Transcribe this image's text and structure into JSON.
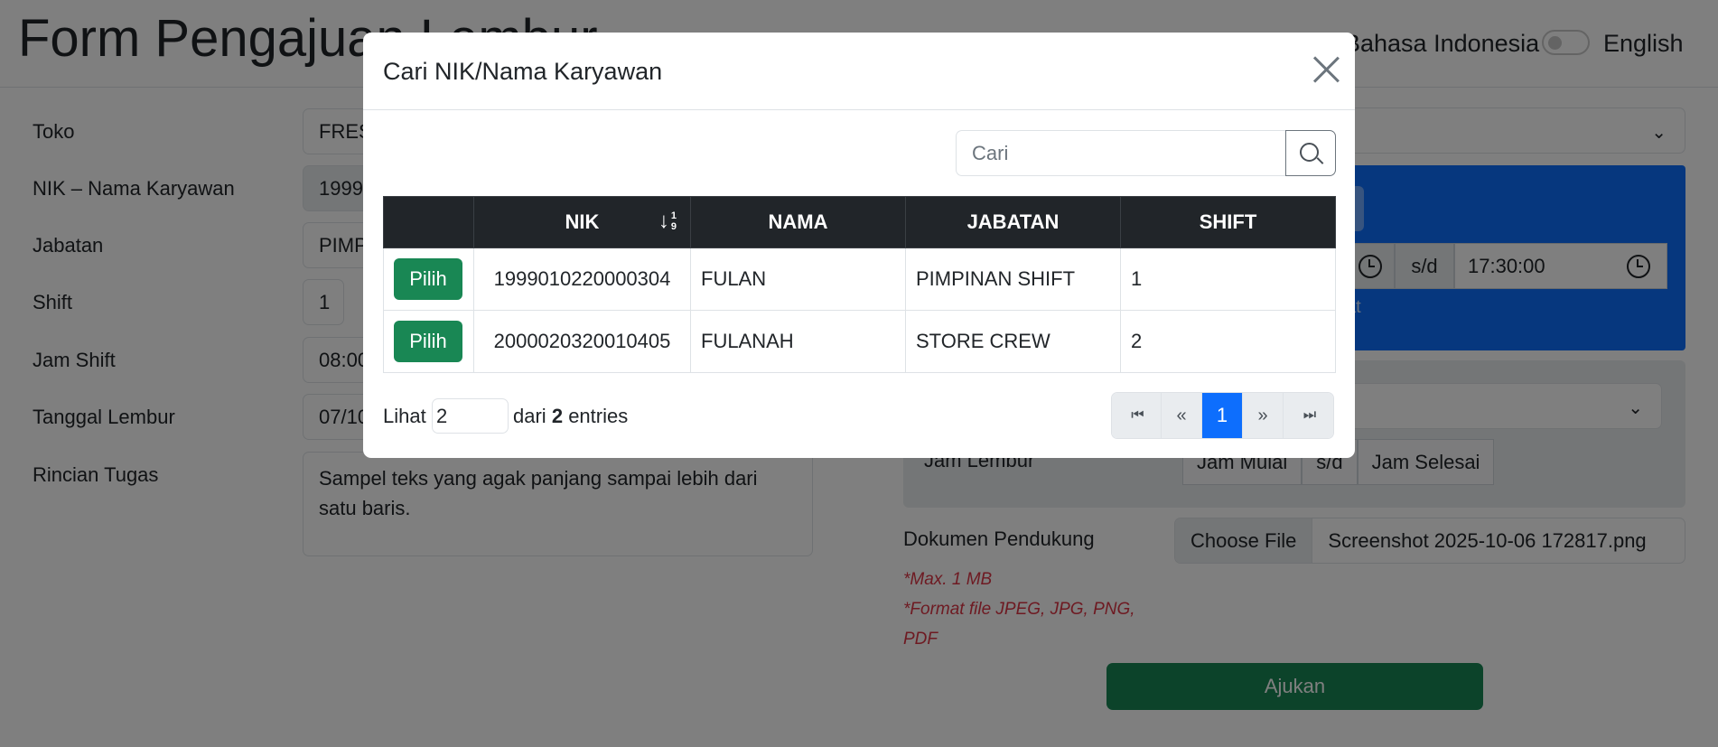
{
  "page": {
    "title": "Form Pengajuan Lembur",
    "lang_id": "Bahasa Indonesia",
    "lang_en": "English"
  },
  "form": {
    "toko_label": "Toko",
    "toko_value": "FRESH",
    "nik_label": "NIK – Nama Karyawan",
    "nik_value": "1999",
    "jabatan_label": "Jabatan",
    "jabatan_value": "PIMP",
    "shift_label": "Shift",
    "shift_value": "1",
    "jam_shift_label": "Jam Shift",
    "jam_shift_value": "08:00",
    "tanggal_label": "Tanggal Lembur",
    "tanggal_value": "07/10",
    "rincian_label": "Rincian Tugas",
    "rincian_value": "Sampel teks yang agak panjang sampai lebih dari satu baris."
  },
  "right": {
    "sd": "s/d",
    "end_time": "17:30:00",
    "blue_note": "at",
    "jam_lembur_label": "Jam Lembur",
    "jam_mulai": "Jam Mulai",
    "jam_sd": "s/d",
    "jam_selesai": "Jam Selesai",
    "dokumen_label": "Dokumen Pendukung",
    "choose_file": "Choose File",
    "file_name": "Screenshot 2025-10-06 172817.png",
    "note_max": "*Max. 1 MB",
    "note_format_1": "*Format file JPEG, JPG, PNG,",
    "note_format_2": "PDF",
    "submit": "Ajukan"
  },
  "modal": {
    "title": "Cari NIK/Nama Karyawan",
    "search_placeholder": "Cari",
    "columns": [
      "",
      "NIK",
      "NAMA",
      "JABATAN",
      "SHIFT"
    ],
    "sort_nums": [
      "1",
      "9"
    ],
    "rows": [
      {
        "action": "Pilih",
        "nik": "1999010220000304",
        "nama": "FULAN",
        "jabatan": "PIMPINAN SHIFT",
        "shift": "1"
      },
      {
        "action": "Pilih",
        "nik": "2000020320010405",
        "nama": "FULANAH",
        "jabatan": "STORE CREW",
        "shift": "2"
      }
    ],
    "lihat": "Lihat",
    "page_length": "2",
    "dari": "dari",
    "total": "2",
    "entries": "entries",
    "pager": {
      "first": "⏮",
      "prev": "«",
      "current": "1",
      "next": "»",
      "last": "⏭"
    }
  }
}
